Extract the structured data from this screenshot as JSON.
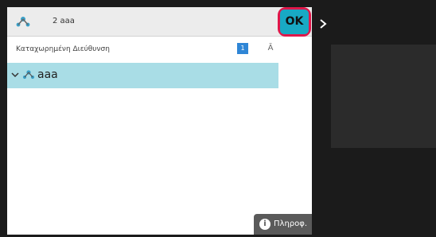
{
  "header": {
    "address_text": "2  aaa"
  },
  "registered": {
    "label": "Καταχωρημένη Διεύθυνση",
    "count": "1",
    "sort_label": "Ā"
  },
  "selected_item": {
    "name": "aaa"
  },
  "info_button": {
    "icon_text": "i",
    "label": "Πληροφ."
  },
  "ok_button": {
    "label": "OK"
  },
  "colors": {
    "accent": "#18a9c4",
    "highlight": "#e0174a",
    "selected_row": "#a9dde6",
    "count_badge": "#2f86d6"
  },
  "icons": [
    "address-book-icon",
    "chevron-down-icon",
    "group-icon",
    "info-icon",
    "arrow-right-icon",
    "sort-icon"
  ]
}
